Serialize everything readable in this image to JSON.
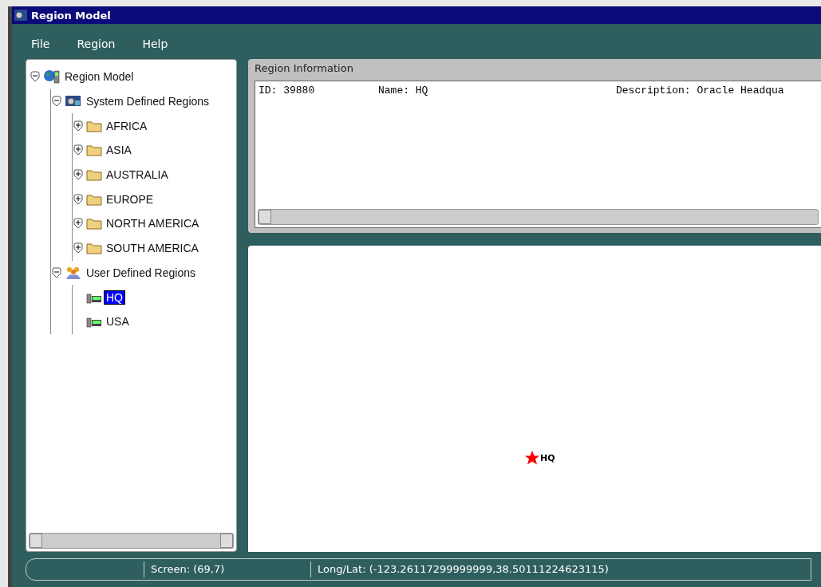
{
  "window": {
    "title": "Region Model"
  },
  "menu": [
    "File",
    "Region",
    "Help"
  ],
  "tree": [
    {
      "label": "Region Model",
      "kind": "globe",
      "expanded": true,
      "selected": false,
      "children": [
        {
          "label": "System Defined Regions",
          "kind": "system",
          "expanded": true,
          "selected": false,
          "children": [
            {
              "label": "AFRICA",
              "kind": "folder",
              "expanded": false,
              "selected": false
            },
            {
              "label": "ASIA",
              "kind": "folder",
              "expanded": false,
              "selected": false
            },
            {
              "label": "AUSTRALIA",
              "kind": "folder",
              "expanded": false,
              "selected": false
            },
            {
              "label": "EUROPE",
              "kind": "folder",
              "expanded": false,
              "selected": false
            },
            {
              "label": "NORTH AMERICA",
              "kind": "folder",
              "expanded": false,
              "selected": false
            },
            {
              "label": "SOUTH AMERICA",
              "kind": "folder",
              "expanded": false,
              "selected": false
            }
          ]
        },
        {
          "label": "User Defined Regions",
          "kind": "users",
          "expanded": true,
          "selected": false,
          "children": [
            {
              "label": "HQ",
              "kind": "region",
              "selected": true
            },
            {
              "label": "USA",
              "kind": "region",
              "selected": false
            }
          ]
        }
      ]
    }
  ],
  "region_information": {
    "title": "Region Information",
    "id": "ID: 39880",
    "name": "Name: HQ",
    "description": "Description: Oracle Headqua"
  },
  "map": {
    "marker": {
      "label": "HQ"
    }
  },
  "status_bar": {
    "screen": "Screen: (69,7)",
    "long_lat": "Long/Lat: (-123.26117299999999,38.50111224623115)"
  }
}
